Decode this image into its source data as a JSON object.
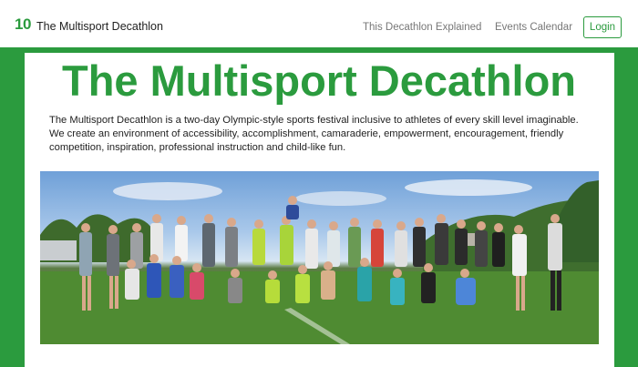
{
  "nav": {
    "logo_text": "10",
    "brand_name": "The Multisport Decathlon",
    "links": [
      {
        "label": "This Decathlon Explained"
      },
      {
        "label": "Events Calendar"
      }
    ],
    "login_label": "Login"
  },
  "main": {
    "title": "The Multisport Decathlon",
    "intro": "The Multisport Decathlon is a two-day Olympic-style sports festival inclusive to athletes of every skill level imaginable. We create an environment of accessibility, accomplishment, camaraderie, empowerment, encouragement, friendly competition, inspiration, professional instruction and child-like fun.",
    "photo_description_icon": "group-photo-image"
  },
  "colors": {
    "brand_green": "#2b9b3e",
    "text_dark": "#222222",
    "nav_gray": "#777777"
  }
}
